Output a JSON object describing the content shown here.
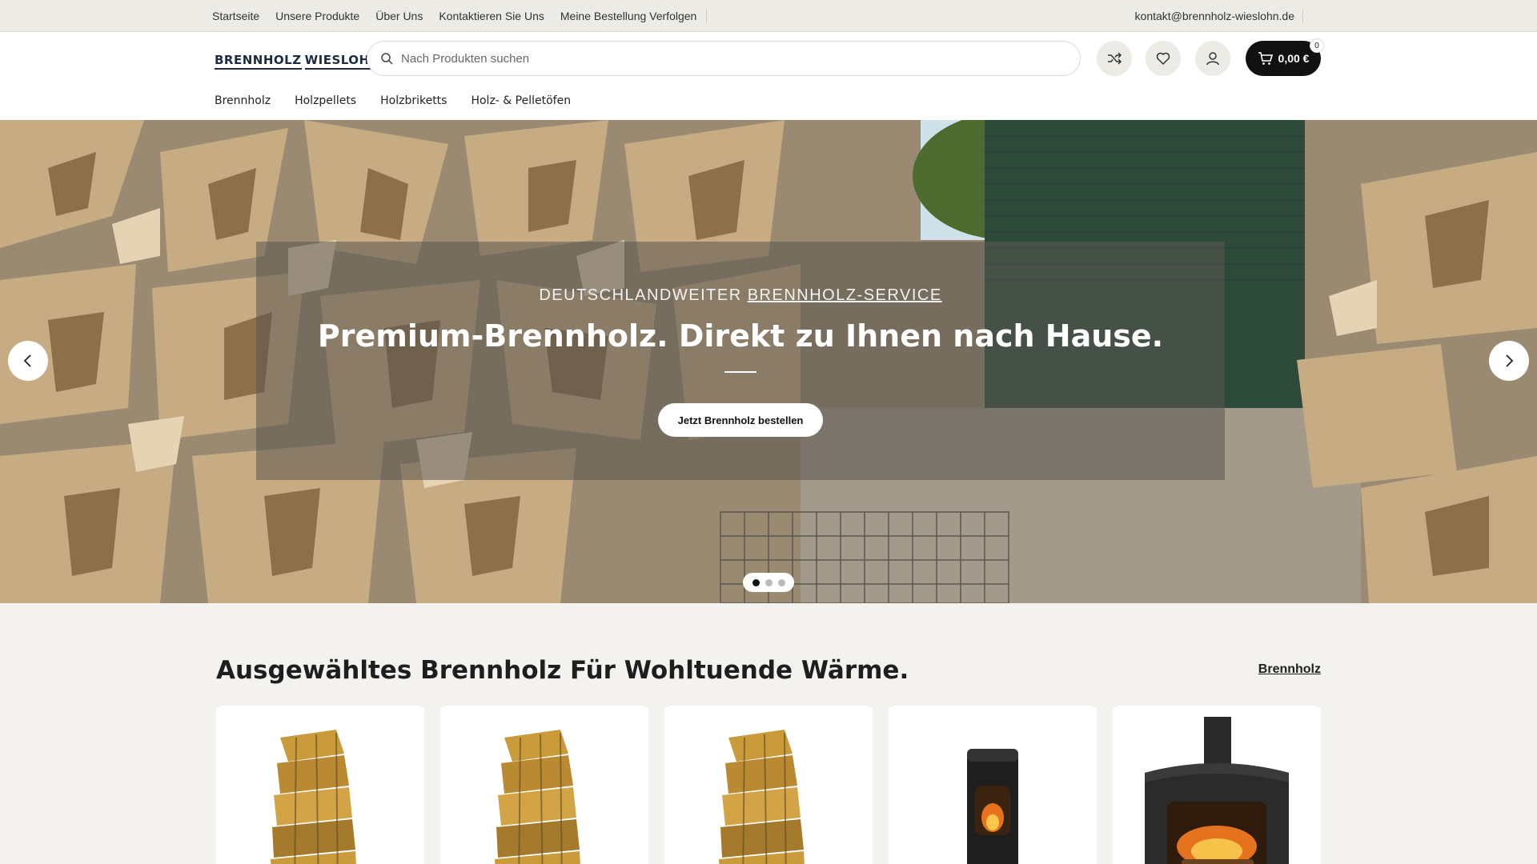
{
  "topbar": {
    "links": [
      "Startseite",
      "Unsere Produkte",
      "Über Uns",
      "Kontaktieren Sie Uns",
      "Meine Bestellung Verfolgen"
    ],
    "email": "kontakt@brennholz-wieslohn.de"
  },
  "header": {
    "logo_left": "BRENNHOLZ",
    "logo_right": "WIESLOHN",
    "search_placeholder": "Nach Produkten suchen",
    "cart_total": "0,00 €",
    "cart_count": "0",
    "nav": [
      "Brennholz",
      "Holzpellets",
      "Holzbriketts",
      "Holz- & Pelletöfen"
    ]
  },
  "hero": {
    "eyebrow_prefix": "DEUTSCHLANDWEITER",
    "eyebrow_link": "BRENNHOLZ-SERVICE",
    "title": "Premium-Brennholz. Direkt zu Ihnen nach Hause.",
    "cta": "Jetzt Brennholz bestellen",
    "slides": 3,
    "active_slide": 1
  },
  "section": {
    "title": "Ausgewähltes Brennholz Für Wohltuende Wärme.",
    "link": "Brennholz"
  },
  "colors": {
    "accent": "#111111",
    "background": "#f4f2ee",
    "flame": "#e85b2a"
  }
}
